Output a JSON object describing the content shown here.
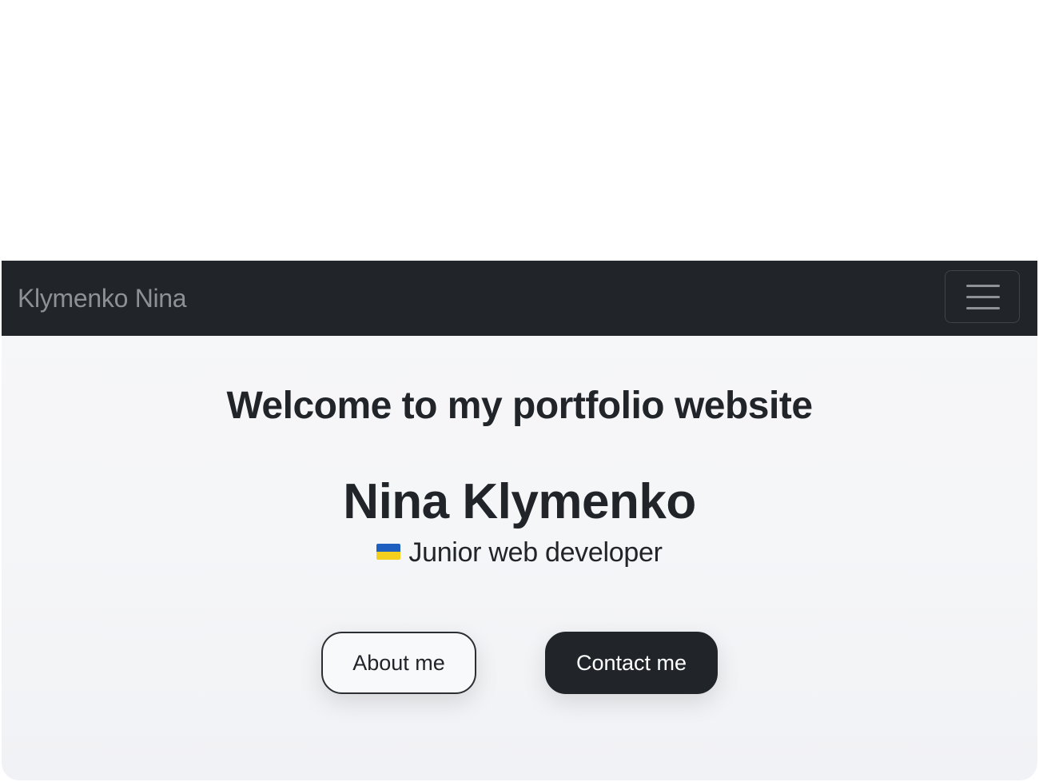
{
  "navbar": {
    "brand": "Klymenko Nina",
    "toggler_icon": "hamburger-menu-icon"
  },
  "hero": {
    "welcome": "Welcome to my portfolio website",
    "name": "Nina Klymenko",
    "subtitle_icon": "ukraine-flag-icon",
    "subtitle": "Junior web developer"
  },
  "buttons": {
    "about": "About me",
    "contact": "Contact me"
  },
  "colors": {
    "navbar_bg": "#212529",
    "brand_text": "#8d9094",
    "text_dark": "#212529",
    "flag_blue": "#1f5fbf",
    "flag_yellow": "#f5cf1e"
  }
}
